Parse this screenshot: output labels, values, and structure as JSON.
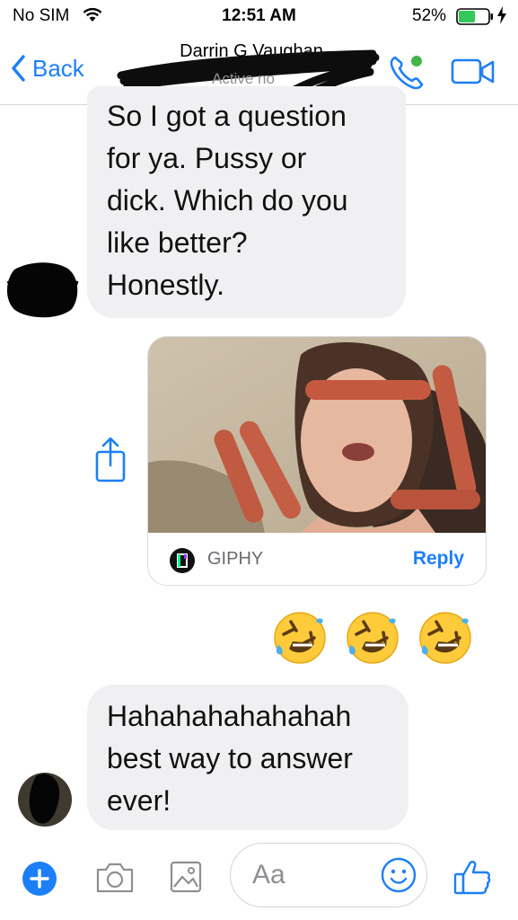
{
  "status_bar": {
    "carrier": "No SIM",
    "time": "12:51 AM",
    "battery_percent": "52%"
  },
  "nav": {
    "back_label": "Back",
    "contact_name": "Darrin G Vaughan",
    "presence": "Active no"
  },
  "messages": {
    "question_lines": [
      "So I got a question",
      "for ya. Pussy or",
      "dick. Which do you",
      "like better?",
      "Honestly."
    ],
    "gif_source": "GIPHY",
    "gif_action": "Reply",
    "reply_emojis": [
      "rolling-on-floor-laughing",
      "rolling-on-floor-laughing",
      "rolling-on-floor-laughing"
    ],
    "laugh_lines": [
      "Hahahahahahahah",
      "best way to answer",
      "ever!"
    ]
  },
  "composer": {
    "placeholder": "Aa"
  },
  "colors": {
    "accent": "#1d7ff7",
    "incoming_bubble": "#f0f0f2",
    "online_dot": "#44b649"
  }
}
